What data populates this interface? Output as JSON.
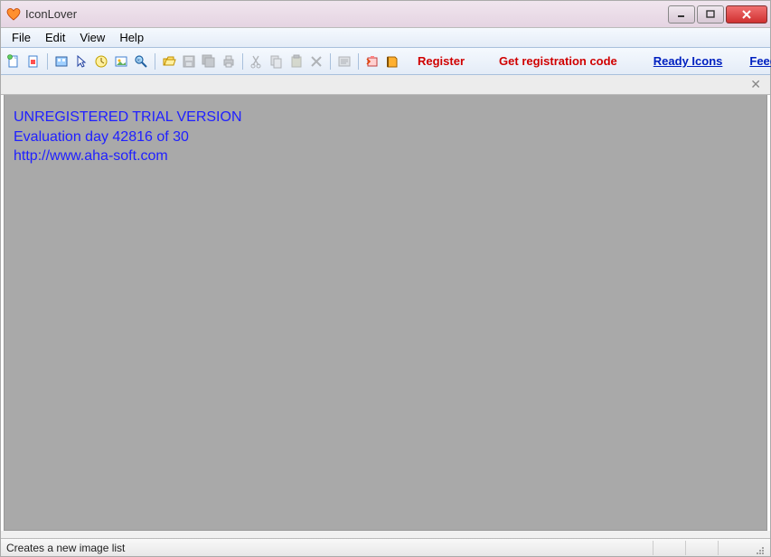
{
  "titlebar": {
    "title": "IconLover"
  },
  "menu": {
    "file": "File",
    "edit": "Edit",
    "view": "View",
    "help": "Help"
  },
  "links": {
    "register": "Register",
    "get_code": "Get registration code",
    "ready_icons": "Ready Icons",
    "feedback": "Feedbac"
  },
  "trial": {
    "line1": "UNREGISTERED TRIAL VERSION",
    "line2": "Evaluation day 42816 of 30",
    "line3": "http://www.aha-soft.com"
  },
  "status": {
    "text": "Creates a new image list"
  }
}
